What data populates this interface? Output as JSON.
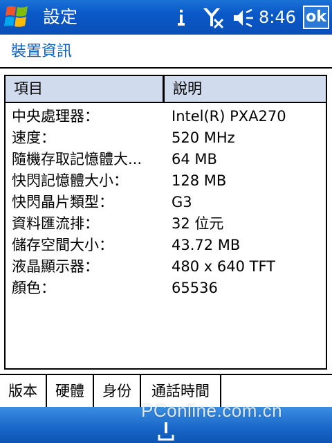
{
  "titlebar": {
    "title": "設定",
    "clock": "8:46",
    "ok_label": "ok"
  },
  "heading": "裝置資訊",
  "list": {
    "columns": [
      "項目",
      "說明"
    ],
    "rows": [
      {
        "key": "中央處理器：",
        "value": "Intel(R) PXA270"
      },
      {
        "key": "速度：",
        "value": "520 MHz"
      },
      {
        "key": "隨機存取記憶體大...",
        "value": "64 MB"
      },
      {
        "key": "快閃記憶體大小：",
        "value": "128 MB"
      },
      {
        "key": "快閃晶片類型：",
        "value": "G3"
      },
      {
        "key": "資料匯流排：",
        "value": "32 位元"
      },
      {
        "key": "儲存空間大小：",
        "value": "43.72 MB"
      },
      {
        "key": "液晶顯示器：",
        "value": "480 x 640 TFT"
      },
      {
        "key": "顏色：",
        "value": "65536"
      }
    ]
  },
  "tabs": [
    {
      "label": "版本",
      "active": false
    },
    {
      "label": "硬體",
      "active": true
    },
    {
      "label": "身份",
      "active": false
    },
    {
      "label": "通話時間",
      "active": false
    }
  ],
  "watermark": "PConline.com.cn",
  "icons": {
    "start": "windows-flag-icon",
    "antenna": "antenna-icon",
    "signal": "no-signal-icon",
    "speaker": "speaker-icon",
    "keyboard": "input-panel-icon"
  },
  "colors": {
    "titlebar": "#0a58c8",
    "heading": "#1460b8",
    "header_row": "#d0dcee"
  }
}
